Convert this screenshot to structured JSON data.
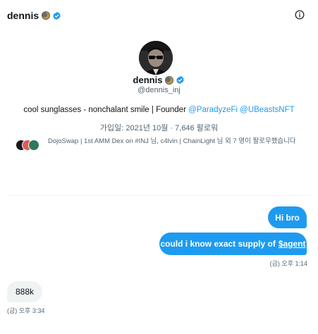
{
  "header": {
    "name": "dennis",
    "info_icon": "info-circle-icon"
  },
  "profile": {
    "display_name": "dennis",
    "handle": "@dennis_inj",
    "bio_text": "cool sunglasses - nonchalant smile | Founder",
    "bio_link1": "@ParadyzeFi",
    "bio_link2": "@UBeastsNFT",
    "joined": "가입일: 2021년 10월 · 7,646 팔로워",
    "followers_known": "DojoSwap | 1st AMM Dex on #INJ 님, c4lvin | ChainLight 님 외 7 명이 팔로우했습니다"
  },
  "messages": {
    "sent": [
      {
        "text": "Hi bro"
      },
      {
        "text_before": "could i know exact supply of",
        "cashtag": "$agent"
      }
    ],
    "sent_timestamp": "(금) 오후 1:14",
    "received": [
      {
        "text": "888k"
      }
    ],
    "received_timestamp": "(금) 오후 3:34"
  },
  "colors": {
    "accent": "#1d9bf0",
    "received_bubble": "#eff3f4",
    "secondary_text": "#536471",
    "primary_text": "#0f1419"
  }
}
